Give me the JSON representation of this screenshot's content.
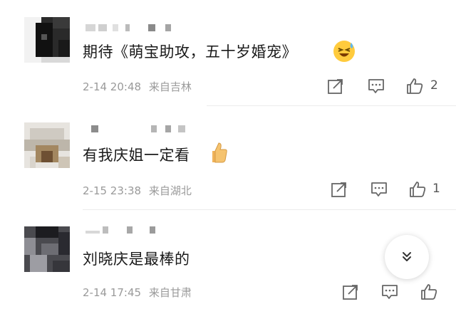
{
  "comments": [
    {
      "text": "期待《萌宝助攻，五十岁婚宠》",
      "emoji": "laughing-with-sweat-emoji",
      "date": "2-14 20:48",
      "source": "来自吉林",
      "likes": "2"
    },
    {
      "text": "有我庆姐一定看",
      "emoji": "thumbs-up-emoji",
      "date": "2-15 23:38",
      "source": "来自湖北",
      "likes": "1"
    },
    {
      "text": "刘晓庆是最棒的",
      "emoji": "",
      "date": "2-14 17:45",
      "source": "来自甘肃",
      "likes": ""
    }
  ],
  "icons": {
    "repost": "repost-icon",
    "comment": "comment-icon",
    "like": "like-icon",
    "scroll": "chevron-double-down-icon"
  },
  "colors": {
    "text": "#1a1a1a",
    "meta": "#9a9a9a",
    "icon": "#666666"
  }
}
